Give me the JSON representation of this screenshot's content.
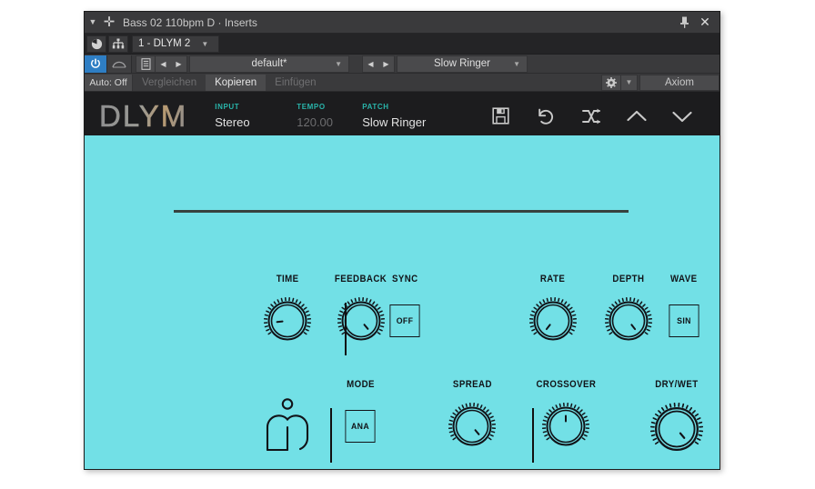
{
  "window": {
    "title": "Bass 02 110bpm D · Inserts",
    "caret_icon": "triangle-down-icon",
    "plus_icon": "plus-icon",
    "pin_icon": "pin-icon",
    "close_icon": "close-icon"
  },
  "slot_row": {
    "bypass_icon": "power-circle-icon",
    "routing_icon": "routing-tree-icon",
    "slot_label": "1 - DLYM 2",
    "slot_arrow": "▼"
  },
  "toolbar": {
    "power_icon": "power-icon",
    "curve_icon": "automation-curve-icon",
    "doc_icon": "preset-document-icon",
    "prev_icon": "◀",
    "next_icon": "▶",
    "preset_name": "default*",
    "preset_arrow": "▼",
    "patch_prev_icon": "◀",
    "patch_next_icon": "▶",
    "patch_name": "Slow Ringer",
    "patch_arrow": "▼",
    "auto_label": "Auto: Off",
    "compare_label": "Vergleichen",
    "copy_label": "Kopieren",
    "paste_label": "Einfügen",
    "gear_icon": "gear-icon",
    "gear_arrow": "▼",
    "controller_name": "Axiom"
  },
  "plugin": {
    "logo_text": "DLYM",
    "meta": [
      {
        "label": "INPUT",
        "value": "Stereo",
        "dim": false
      },
      {
        "label": "TEMPO",
        "value": "120.00",
        "dim": true
      },
      {
        "label": "PATCH",
        "value": "Slow Ringer",
        "dim": false
      }
    ],
    "header_icons": [
      {
        "name": "save-icon"
      },
      {
        "name": "undo-icon"
      },
      {
        "name": "randomize-icon"
      },
      {
        "name": "chevron-up-icon"
      },
      {
        "name": "chevron-down-icon"
      }
    ],
    "accent_color": "#29b5ab",
    "panel_color": "#72e0e6",
    "ink_color": "#111318"
  },
  "controls": {
    "row1": [
      {
        "name": "time",
        "caption": "TIME",
        "type": "knob",
        "angle": -96
      },
      {
        "name": "feedback",
        "caption": "FEEDBACK",
        "type": "knob",
        "angle": 140
      },
      {
        "name": "sync",
        "caption": "SYNC",
        "type": "button",
        "value": "OFF"
      },
      {
        "name": "rate",
        "caption": "RATE",
        "type": "knob",
        "angle": -142
      },
      {
        "name": "depth",
        "caption": "DEPTH",
        "type": "knob",
        "angle": 142
      },
      {
        "name": "wave",
        "caption": "WAVE",
        "type": "button",
        "value": "SIN"
      }
    ],
    "row2": [
      {
        "name": "mode",
        "caption": "MODE",
        "type": "button",
        "value": "ANA"
      },
      {
        "name": "spread",
        "caption": "SPREAD",
        "type": "knob",
        "angle": 140
      },
      {
        "name": "crossover",
        "caption": "CROSSOVER",
        "type": "knob",
        "angle": 0
      },
      {
        "name": "drywet",
        "caption": "DRY/WET",
        "type": "knob",
        "angle": 140
      }
    ],
    "brand_icon": "minimal-audio-m-logo"
  }
}
